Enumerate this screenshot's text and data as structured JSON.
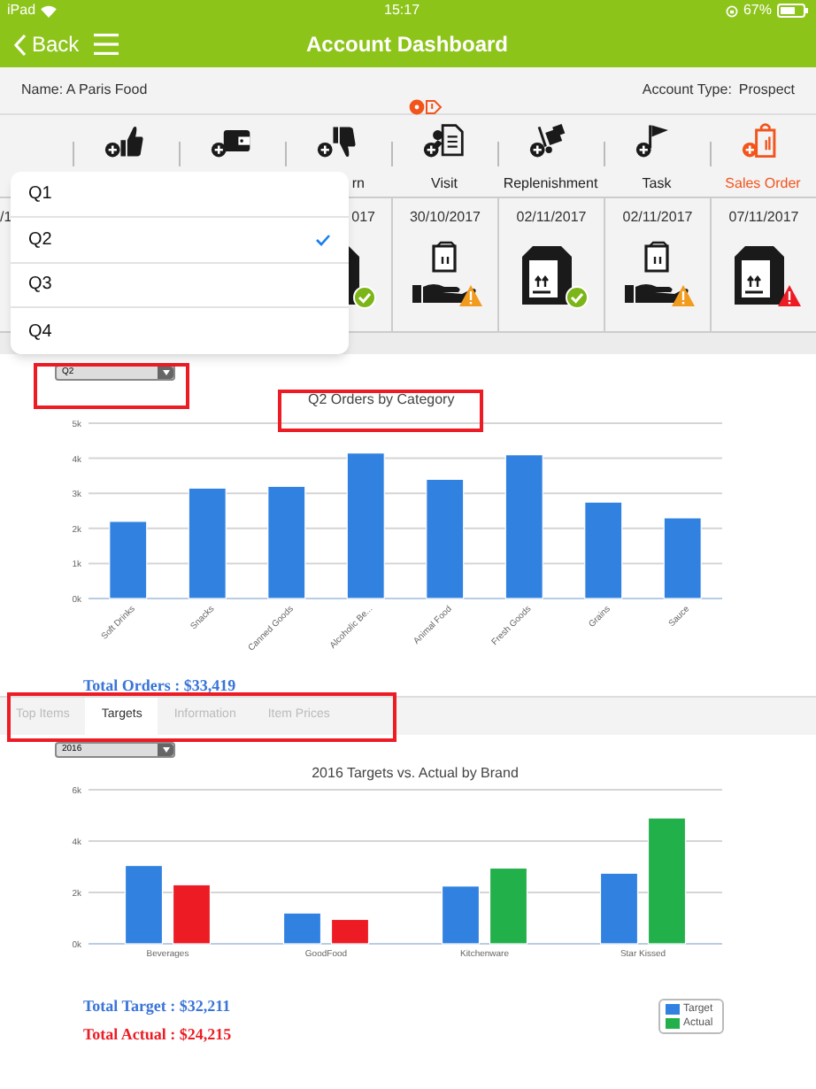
{
  "status_bar": {
    "carrier": "iPad",
    "time": "15:17",
    "battery": "67%"
  },
  "nav": {
    "back": "Back",
    "title": "Account Dashboard"
  },
  "account": {
    "name": "Name: A Paris Food",
    "type_label": "Account Type:",
    "type_value": "Prospect"
  },
  "actions": [
    {
      "kind": "thumb-up",
      "selected": false
    },
    {
      "kind": "wallet",
      "selected": false
    },
    {
      "kind": "thumb-down",
      "label": "rn",
      "selected": false
    },
    {
      "kind": "visit",
      "label": "Visit",
      "selected": false
    },
    {
      "kind": "replenishment",
      "label": "Replenishment",
      "selected": false
    },
    {
      "kind": "task",
      "label": "Task",
      "selected": false
    },
    {
      "kind": "sales-order",
      "label": "Sales Order",
      "selected": true
    }
  ],
  "timeline": [
    {
      "date": "/1"
    },
    {
      "date": "017",
      "kind": "box",
      "badge": {
        "kind": "check"
      }
    },
    {
      "date": "30/10/2017",
      "kind": "hand",
      "badge": {
        "kind": "warning"
      }
    },
    {
      "date": "02/11/2017",
      "kind": "box",
      "badge": {
        "kind": "check"
      }
    },
    {
      "date": "02/11/2017",
      "kind": "hand",
      "badge": {
        "kind": "warning"
      }
    },
    {
      "date": "07/11/2017",
      "kind": "box",
      "badge": {
        "kind": "alert"
      }
    }
  ],
  "quarter_menu": [
    {
      "label": "Q1",
      "selected": false
    },
    {
      "label": "Q2",
      "selected": true
    },
    {
      "label": "Q3",
      "selected": false
    },
    {
      "label": "Q4",
      "selected": false
    }
  ],
  "orders": {
    "dropdown": "Q2",
    "chart_data": {
      "type": "bar",
      "title": "Q2 Orders by Category",
      "categories": [
        "Soft Drinks",
        "Snacks",
        "Canned Goods",
        "Alcoholic Be...",
        "Animal Food",
        "Fresh Goods",
        "Grains",
        "Sauce"
      ],
      "grid": true,
      "series": [
        {
          "color": "#3182e0",
          "values": [
            2200,
            3150,
            3200,
            4150,
            3400,
            4100,
            2750,
            2300
          ]
        }
      ],
      "ylim": [
        0,
        5000
      ],
      "yticks": [
        {
          "value": 0,
          "label": "0k"
        },
        {
          "value": 1000,
          "label": "1k"
        },
        {
          "value": 2000,
          "label": "2k"
        },
        {
          "value": 3000,
          "label": "3k"
        },
        {
          "value": 4000,
          "label": "4k"
        },
        {
          "value": 5000,
          "label": "5k"
        }
      ]
    },
    "total": "Total Orders : $33,419"
  },
  "tabs": [
    {
      "label": "Top Items",
      "selected": false
    },
    {
      "label": "Targets",
      "selected": true
    },
    {
      "label": "Information",
      "selected": false
    },
    {
      "label": "Item Prices",
      "selected": false
    }
  ],
  "targets": {
    "dropdown": "2016",
    "chart_data": {
      "type": "bar",
      "title": "2016 Targets vs. Actual by Brand",
      "categories": [
        "Beverages",
        "GoodFood",
        "Kitchenware",
        "Star Kissed"
      ],
      "grid": true,
      "series": [
        {
          "name": "Target",
          "color": "#3182e0",
          "values": [
            3050,
            1200,
            2250,
            2750
          ]
        },
        {
          "name": "Actual",
          "color": "#22b04b",
          "colors": [
            "#ed1c24",
            "#ed1c24",
            "#22b04b",
            "#22b04b"
          ],
          "values": [
            2300,
            950,
            2950,
            4900
          ]
        }
      ],
      "ylim": [
        0,
        6000
      ],
      "yticks": [
        {
          "value": 0,
          "label": "0k"
        },
        {
          "value": 2000,
          "label": "2k"
        },
        {
          "value": 4000,
          "label": "4k"
        },
        {
          "value": 6000,
          "label": "6k"
        }
      ]
    },
    "total_target": "Total Target : $32,211",
    "total_actual": "Total Actual : $24,215"
  }
}
